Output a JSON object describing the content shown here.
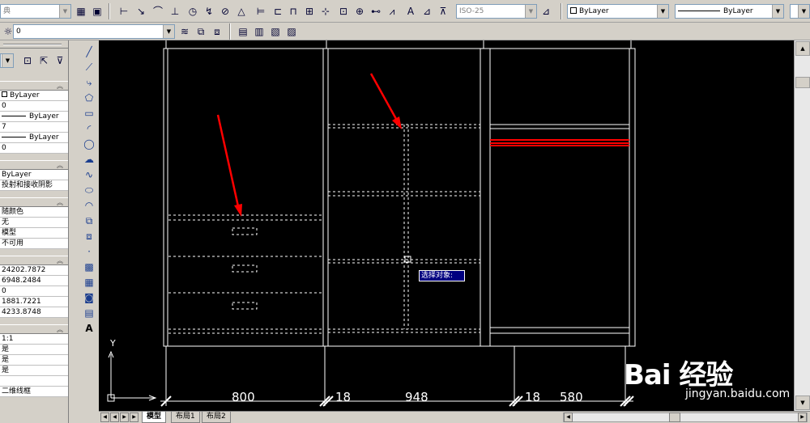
{
  "toolbar1": {
    "style_combo": "典",
    "dimstyle_combo": "ISO-25",
    "layer_color_combo": "ByLayer",
    "linetype_combo": "ByLayer",
    "lineweight_combo": "ByLayer"
  },
  "toolbar2": {
    "layer_combo": "0"
  },
  "palette": {
    "general_rows": [
      "ByLayer",
      "0",
      "ByLayer",
      "7",
      "ByLayer",
      "0"
    ],
    "three_d_rows": [
      "ByLayer",
      "投射和接收阴影"
    ],
    "material_rows": [
      "随颜色",
      "无",
      "模型",
      "不可用"
    ],
    "geometry_rows": [
      "24202.7872",
      "6948.2484",
      "0",
      "1881.7221",
      "4233.8748"
    ],
    "misc_rows": [
      "1:1",
      "是",
      "是",
      "是",
      "",
      "二维线框"
    ]
  },
  "canvas": {
    "prompt": "选择对象:",
    "ucs_y": "Y",
    "dims": [
      {
        "value": "800"
      },
      {
        "value": "18"
      },
      {
        "value": "948"
      },
      {
        "value": "18"
      },
      {
        "value": "580"
      }
    ],
    "watermark_brand": "Bai 经验",
    "watermark_url": "jingyan.baidu.com",
    "colors": {
      "background": "#000000",
      "line": "#ffffff",
      "arrow": "#ff0000",
      "highlight": "#ff0000"
    }
  },
  "tabs": [
    {
      "label": "模型",
      "active": true
    },
    {
      "label": "布局1",
      "active": false
    },
    {
      "label": "布局2",
      "active": false
    }
  ]
}
